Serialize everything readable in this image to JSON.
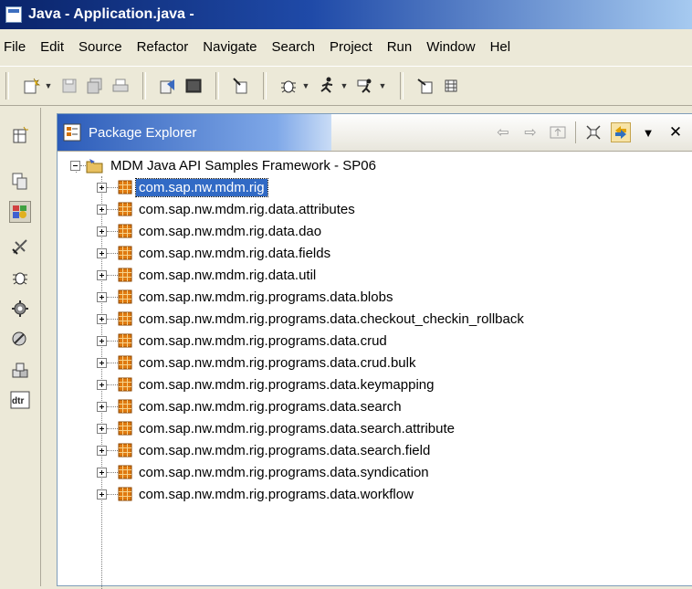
{
  "window": {
    "title": "Java - Application.java -"
  },
  "menu": [
    "File",
    "Edit",
    "Source",
    "Refactor",
    "Navigate",
    "Search",
    "Project",
    "Run",
    "Window",
    "Hel"
  ],
  "toolbar_icons": [
    "new-wizard-icon",
    "save-icon",
    "save-all-icon",
    "print-icon",
    "open-type-icon",
    "open-console-icon",
    "mdm-tool-icon",
    "debug-icon",
    "run-icon",
    "external-tools-icon",
    "open-perspective-icon",
    "new-package-icon"
  ],
  "left_shortcuts": [
    "open-perspective-icon",
    "resource-perspective-icon",
    "java-perspective-icon",
    "team-sync-icon",
    "debug-perspective-icon",
    "plugin-icon",
    "cvs-icon",
    "java-browsing-icon",
    "dtr-icon"
  ],
  "view": {
    "title": "Package Explorer",
    "tools": [
      "back-icon",
      "forward-icon",
      "up-icon",
      "collapse-all-icon",
      "link-with-editor-icon",
      "view-menu-icon",
      "close-icon"
    ]
  },
  "tree": {
    "project": "MDM Java API Samples Framework - SP06",
    "selected_index": 0,
    "packages": [
      "com.sap.nw.mdm.rig",
      "com.sap.nw.mdm.rig.data.attributes",
      "com.sap.nw.mdm.rig.data.dao",
      "com.sap.nw.mdm.rig.data.fields",
      "com.sap.nw.mdm.rig.data.util",
      "com.sap.nw.mdm.rig.programs.data.blobs",
      "com.sap.nw.mdm.rig.programs.data.checkout_checkin_rollback",
      "com.sap.nw.mdm.rig.programs.data.crud",
      "com.sap.nw.mdm.rig.programs.data.crud.bulk",
      "com.sap.nw.mdm.rig.programs.data.keymapping",
      "com.sap.nw.mdm.rig.programs.data.search",
      "com.sap.nw.mdm.rig.programs.data.search.attribute",
      "com.sap.nw.mdm.rig.programs.data.search.field",
      "com.sap.nw.mdm.rig.programs.data.syndication",
      "com.sap.nw.mdm.rig.programs.data.workflow"
    ]
  }
}
